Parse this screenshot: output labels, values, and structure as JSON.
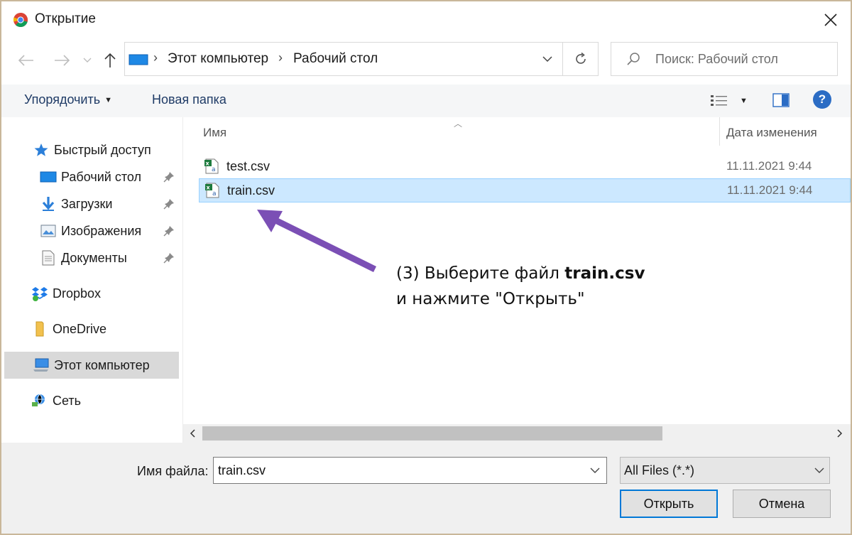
{
  "window": {
    "title": "Открытие"
  },
  "address": {
    "segments": [
      "Этот компьютер",
      "Рабочий стол"
    ],
    "separator": "›",
    "refresh_icon": "refresh-icon"
  },
  "search": {
    "placeholder": "Поиск: Рабочий стол"
  },
  "toolbar": {
    "organize_label": "Упорядочить",
    "new_folder_label": "Новая папка",
    "help_label": "?"
  },
  "nav": {
    "items": [
      {
        "label": "Быстрый доступ",
        "icon": "star-icon"
      },
      {
        "label": "Рабочий стол",
        "icon": "desktop-icon",
        "pinned": true
      },
      {
        "label": "Загрузки",
        "icon": "download-icon",
        "pinned": true
      },
      {
        "label": "Изображения",
        "icon": "pictures-icon",
        "pinned": true
      },
      {
        "label": "Документы",
        "icon": "documents-icon",
        "pinned": true
      },
      {
        "label": "Dropbox",
        "icon": "dropbox-icon"
      },
      {
        "label": "OneDrive",
        "icon": "onedrive-icon"
      },
      {
        "label": "Этот компьютер",
        "icon": "computer-icon",
        "selected": true
      },
      {
        "label": "Сеть",
        "icon": "network-icon"
      }
    ]
  },
  "columns": {
    "name": "Имя",
    "date": "Дата изменения"
  },
  "files": [
    {
      "name": "test.csv",
      "date": "11.11.2021 9:44",
      "selected": false
    },
    {
      "name": "train.csv",
      "date": "11.11.2021 9:44",
      "selected": true
    }
  ],
  "annotation": {
    "line1_prefix": "(3) Выберите файл ",
    "line1_bold": "train.csv",
    "line2": "и нажмите \"Открыть\"",
    "arrow_color": "#7b4fb5"
  },
  "bottom": {
    "filename_label": "Имя файла:",
    "filename_value": "train.csv",
    "filetype_value": "All Files (*.*)",
    "open_label": "Открыть",
    "cancel_label": "Отмена"
  },
  "colors": {
    "selection_bg": "#cce8ff",
    "selection_border": "#99d1ff",
    "accent": "#0078d7",
    "link_text": "#1f3b66"
  }
}
